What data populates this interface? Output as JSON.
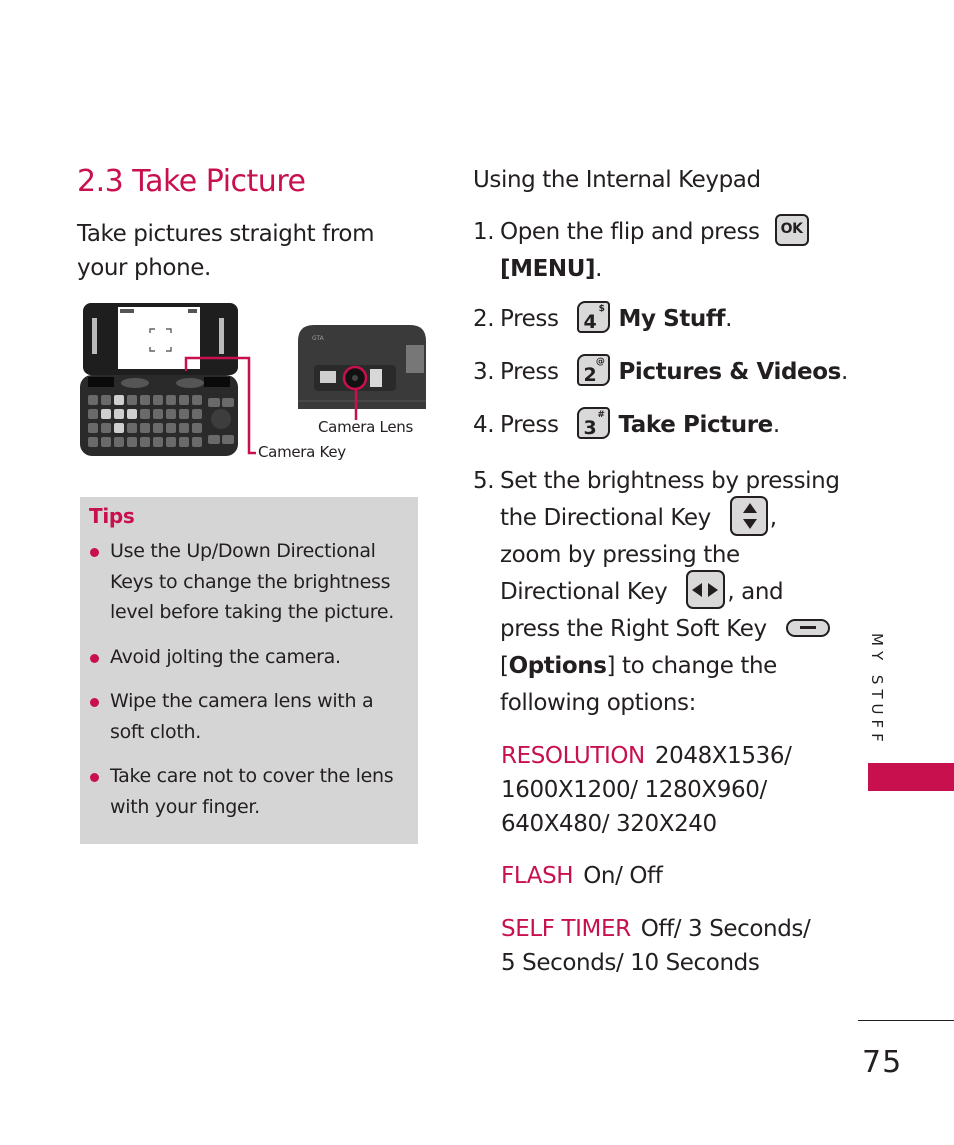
{
  "section": {
    "title": "2.3 Take Picture",
    "intro": "Take pictures straight from your phone."
  },
  "illustration": {
    "camera_lens_label": "Camera Lens",
    "camera_key_label": "Camera Key"
  },
  "tips": {
    "title": "Tips",
    "items": [
      "Use the Up/Down Directional Keys to change the brightness level before taking the picture.",
      "Avoid jolting the camera.",
      "Wipe the camera lens with a soft cloth.",
      "Take care not to cover the lens with your finger."
    ]
  },
  "instructions": {
    "heading": "Using the Internal Keypad",
    "step1": {
      "num": "1.",
      "text_a": "Open the flip and press",
      "key": "OK",
      "text_b": "[MENU]",
      "end": "."
    },
    "step2": {
      "num": "2.",
      "text": "Press",
      "key_digit": "4",
      "key_symbol": "$",
      "target": "My Stuff",
      "end": "."
    },
    "step3": {
      "num": "3.",
      "text": "Press",
      "key_digit": "2",
      "key_symbol": "@",
      "target": "Pictures & Videos",
      "end": "."
    },
    "step4": {
      "num": "4.",
      "text": "Press",
      "key_digit": "3",
      "key_symbol": "#",
      "target": "Take Picture",
      "end": "."
    },
    "step5": {
      "num": "5.",
      "line1": "Set the brightness by pressing",
      "line2": "the Directional Key",
      "line2_end": ",",
      "line3": "zoom by pressing the",
      "line4": "Directional Key",
      "line4_end": ", and",
      "line5": "press the Right Soft Key",
      "line6_open": "[",
      "line6_bold": "Options",
      "line6_rest": "] to change the",
      "line7": "following options:"
    },
    "options": [
      {
        "label": "RESOLUTION",
        "value": "2048X1536/ 1600X1200/ 1280X960/ 640X480/ 320X240"
      },
      {
        "label": "FLASH",
        "value": "On/ Off"
      },
      {
        "label": "SELF TIMER",
        "value": "Off/ 3 Seconds/ 5 Seconds/ 10 Seconds"
      }
    ]
  },
  "side_tab": {
    "label": "MY STUFF"
  },
  "page_number": "75",
  "colors": {
    "accent": "#c8104f",
    "tips_bg": "#d5d5d5",
    "text": "#231f20"
  }
}
